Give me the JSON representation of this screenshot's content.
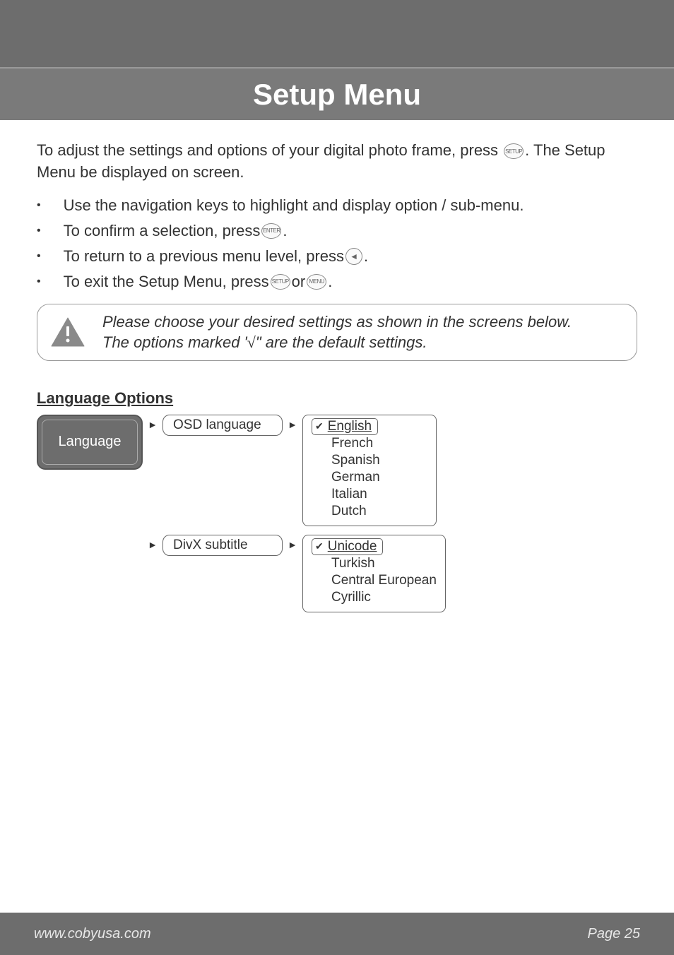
{
  "header": {
    "title": "Setup Menu"
  },
  "intro": {
    "line_prefix": "To adjust the settings and options of your digital photo frame, press ",
    "line_suffix": ". The Setup Menu be displayed on screen.",
    "setup_btn": "SETUP"
  },
  "bullets": {
    "b1": "Use the navigation keys to highlight and display option / sub-menu.",
    "b2_prefix": "To confirm a selection, press ",
    "b2_btn": "ENTER",
    "b3_prefix": "To return to a previous menu level, press ",
    "b3_arrow": "◄",
    "b4_prefix": "To exit the Setup Menu, press ",
    "b4_or": " or ",
    "b4_btn1": "SETUP",
    "b4_btn2": "MENU"
  },
  "note": {
    "line1": "Please choose your desired settings as shown in the screens below.",
    "line2_prefix": "The options marked '",
    "line2_mark": "√",
    "line2_suffix": "\" are the default settings."
  },
  "section_heading": "Language Options",
  "diagram": {
    "main_box": "Language",
    "sub1": "OSD language",
    "sub1_options": {
      "default": "English",
      "others": [
        "French",
        "Spanish",
        "German",
        "Italian",
        "Dutch"
      ]
    },
    "sub2": "DivX subtitle",
    "sub2_options": {
      "default": "Unicode",
      "others": [
        "Turkish",
        "Central European",
        "Cyrillic"
      ]
    }
  },
  "footer": {
    "url": "www.cobyusa.com",
    "page": "Page 25"
  }
}
